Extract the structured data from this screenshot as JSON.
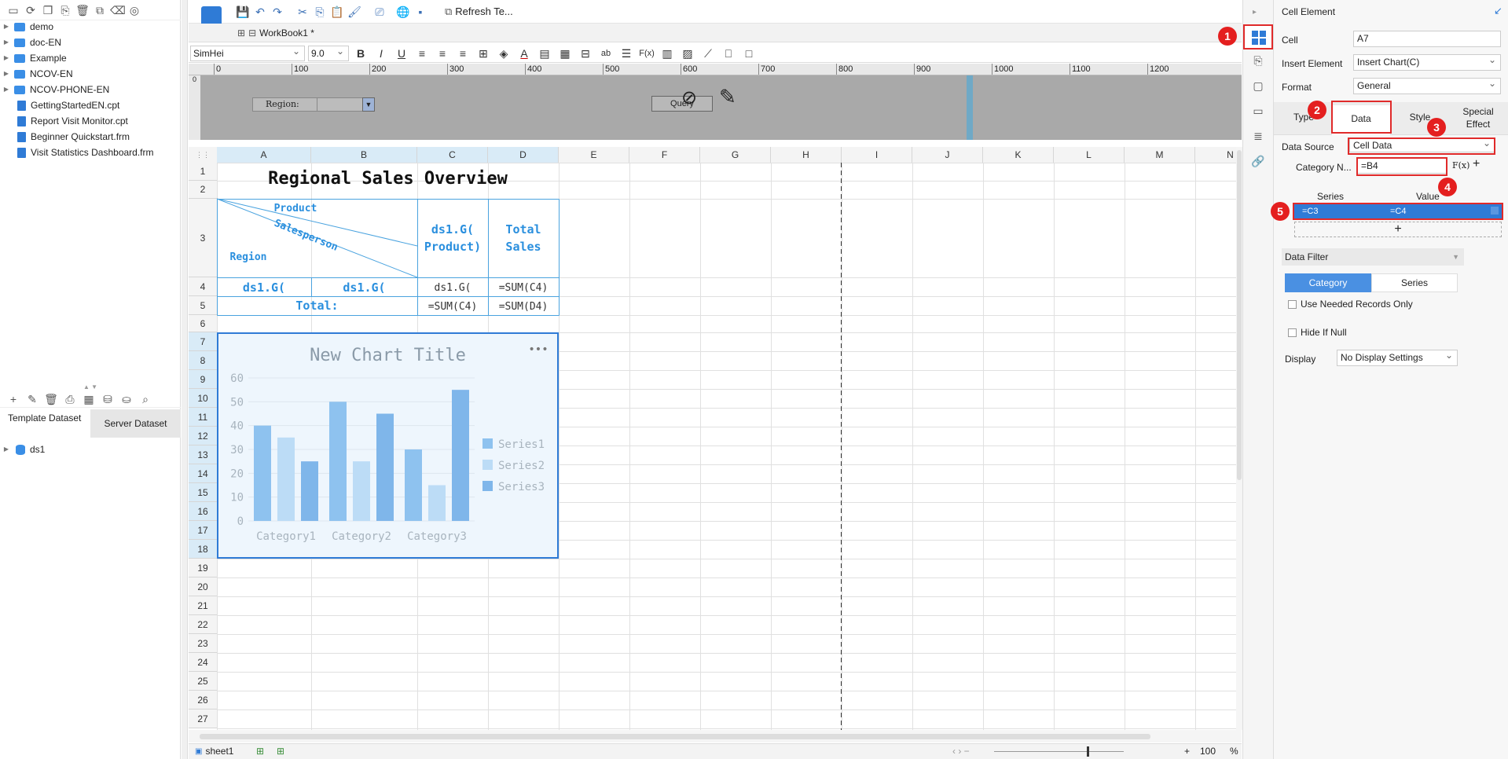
{
  "left": {
    "tree": [
      {
        "label": "demo",
        "type": "folder"
      },
      {
        "label": "doc-EN",
        "type": "folder"
      },
      {
        "label": "Example",
        "type": "folder"
      },
      {
        "label": "NCOV-EN",
        "type": "folder"
      },
      {
        "label": "NCOV-PHONE-EN",
        "type": "folder"
      },
      {
        "label": "GettingStartedEN.cpt",
        "type": "file"
      },
      {
        "label": "Report Visit Monitor.cpt",
        "type": "file"
      },
      {
        "label": "Beginner Quickstart.frm",
        "type": "file"
      },
      {
        "label": "Visit Statistics Dashboard.frm",
        "type": "file"
      }
    ],
    "dataset_tabs": {
      "template": "Template Dataset",
      "server": "Server Dataset"
    },
    "datasets": [
      "ds1"
    ]
  },
  "toolbar": {
    "refresh_label": "Refresh Te...",
    "workbook_tab": "WorkBook1 *",
    "font": "SimHei",
    "font_size": "9.0"
  },
  "ruler": [
    "0",
    "100",
    "200",
    "300",
    "400",
    "500",
    "600",
    "700",
    "800",
    "900",
    "1000",
    "1100",
    "1200"
  ],
  "param": {
    "region_label": "Region:",
    "query_label": "Query"
  },
  "grid": {
    "columns": [
      "A",
      "B",
      "C",
      "D",
      "E",
      "F",
      "G",
      "H",
      "I",
      "J",
      "K",
      "L",
      "M",
      "N"
    ],
    "rows": [
      "1",
      "2",
      "3",
      "4",
      "5",
      "6",
      "7",
      "8",
      "9",
      "10",
      "11",
      "12",
      "13",
      "14",
      "15",
      "16",
      "17",
      "18",
      "19",
      "20",
      "21",
      "22",
      "23",
      "24",
      "25",
      "26",
      "27"
    ],
    "title": "Regional Sales Overview",
    "slash_header": {
      "product": "Product",
      "salesperson": "Salesperson",
      "region": "Region"
    },
    "c3": "ds1.G( Product)",
    "d3": "Total Sales",
    "a4": "ds1.G(",
    "b4": "ds1.G(",
    "c4": "ds1.G(",
    "d4": "=SUM(C4)",
    "total_label": "Total:",
    "c5": "=SUM(C4)",
    "d5": "=SUM(D4)"
  },
  "chart_data": {
    "type": "bar",
    "title": "New Chart Title",
    "categories": [
      "Category1",
      "Category2",
      "Category3"
    ],
    "series": [
      {
        "name": "Series1",
        "values": [
          40,
          50,
          30
        ]
      },
      {
        "name": "Series2",
        "values": [
          35,
          25,
          15
        ]
      },
      {
        "name": "Series3",
        "values": [
          25,
          45,
          55
        ]
      }
    ],
    "yticks": [
      "0",
      "10",
      "20",
      "30",
      "40",
      "50",
      "60"
    ],
    "ylim": [
      0,
      60
    ],
    "legend": "right",
    "colors": [
      "#8ec2ef",
      "#bcdcf6",
      "#7fb6ea"
    ]
  },
  "bottom": {
    "sheet": "sheet1",
    "zoom": "100",
    "percent": "%"
  },
  "right": {
    "header": "Cell Element",
    "cell_label": "Cell",
    "cell_value": "A7",
    "insert_label": "Insert Element",
    "insert_value": "Insert Chart(C)",
    "format_label": "Format",
    "format_value": "General",
    "tabs": [
      "Type",
      "Data",
      "Style",
      "Special Effect"
    ],
    "datasource_label": "Data Source",
    "datasource_value": "Cell Data",
    "category_label": "Category N...",
    "category_value": "=B4",
    "series_col": "Series",
    "value_col": "Value",
    "series_row": {
      "series": "=C3",
      "value": "=C4"
    },
    "add": "+",
    "filter_label": "Data Filter",
    "filter_tabs": [
      "Category",
      "Series"
    ],
    "use_needed": "Use Needed Records Only",
    "hide_null": "Hide If Null",
    "display_label": "Display",
    "display_value": "No Display Settings",
    "badges": [
      "1",
      "2",
      "3",
      "4",
      "5"
    ]
  }
}
